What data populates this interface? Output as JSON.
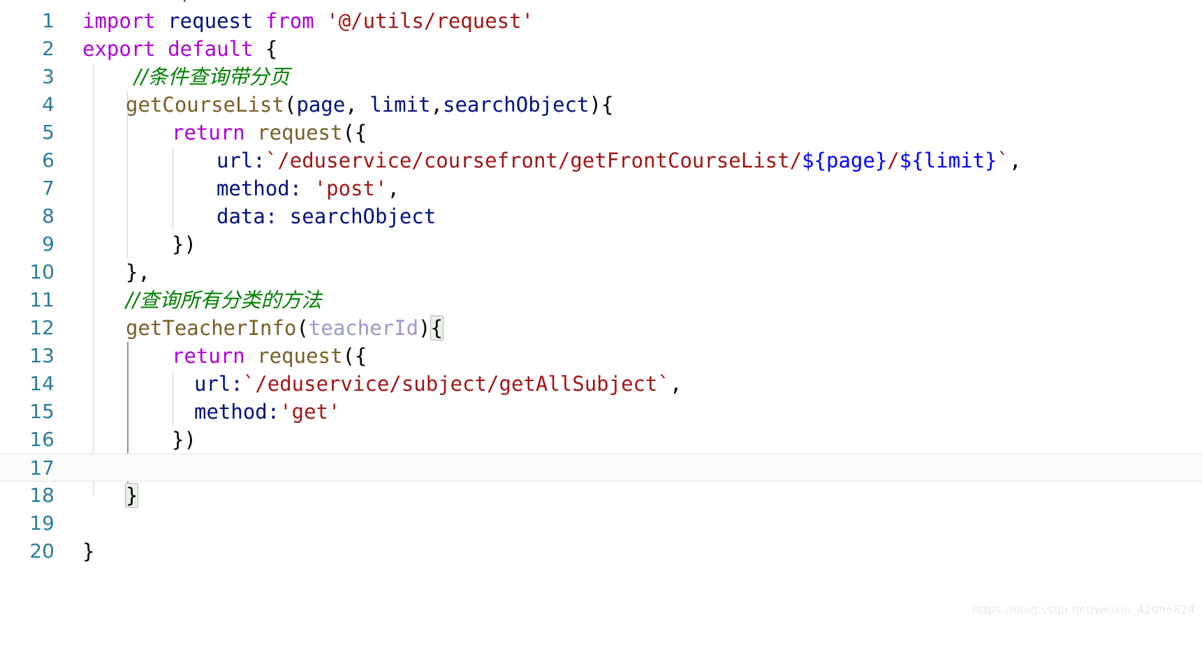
{
  "editor": {
    "title": "code-editor",
    "language": "javascript",
    "background_color": "#ffffff",
    "current_line": 17,
    "total_lines": 20,
    "top_remnant_text": "l       )",
    "gutter": {
      "line_number_color": "#2b7d99",
      "numbers": [
        "1",
        "2",
        "3",
        "4",
        "5",
        "6",
        "7",
        "8",
        "9",
        "10",
        "11",
        "12",
        "13",
        "14",
        "15",
        "16",
        "17",
        "18",
        "19",
        "20"
      ]
    },
    "theme_colors": {
      "keyword": "#af00db",
      "identifier": "#001080",
      "string": "#a31515",
      "comment": "#008000",
      "function": "#795e26",
      "unused_param": "#9b9bc8",
      "punctuation": "#000000",
      "template_expression": "#0000ff",
      "line_number": "#2b7d99",
      "indent_guide": "#d3d3d3",
      "indent_guide_active": "#939393",
      "current_line_bg": "#fbfbfb",
      "bracket_match_bg": "#e8f0e8"
    },
    "lines": [
      {
        "n": "1",
        "text": "import request from '@/utils/request'"
      },
      {
        "n": "2",
        "text": "export default {"
      },
      {
        "n": "3",
        "text": "    //条件查询带分页"
      },
      {
        "n": "4",
        "text": "  getCourseList(page, limit,searchObject){"
      },
      {
        "n": "5",
        "text": "      return request({"
      },
      {
        "n": "6",
        "text": "        url:`/eduservice/coursefront/getFrontCourseList/${page}/${limit}`,"
      },
      {
        "n": "7",
        "text": "        method: 'post',"
      },
      {
        "n": "8",
        "text": "        data: searchObject"
      },
      {
        "n": "9",
        "text": "      })"
      },
      {
        "n": "10",
        "text": "  },"
      },
      {
        "n": "11",
        "text": "  //查询所有分类的方法"
      },
      {
        "n": "12",
        "text": "  getTeacherInfo(teacherId){"
      },
      {
        "n": "13",
        "text": "      return request({"
      },
      {
        "n": "14",
        "text": "       url:`/eduservice/subject/getAllSubject`,"
      },
      {
        "n": "15",
        "text": "       method:'get'"
      },
      {
        "n": "16",
        "text": "      })"
      },
      {
        "n": "17",
        "text": ""
      },
      {
        "n": "18",
        "text": "  }"
      },
      {
        "n": "19",
        "text": ""
      },
      {
        "n": "20",
        "text": "}"
      }
    ],
    "tokens": {
      "l1": {
        "import": "import",
        "request": " request",
        "from": " from",
        "space": " ",
        "module": "'@/utils/request'"
      },
      "l2": {
        "export": "export",
        "default": " default",
        "brace": " {"
      },
      "l3": {
        "comment": "//条件查询带分页"
      },
      "l4": {
        "fname": "getCourseList",
        "open": "(",
        "p1": "page",
        "comma1": ", ",
        "p2": "limit",
        "comma2": ",",
        "p3": "searchObject",
        "close": ")",
        "brace": "{"
      },
      "l5": {
        "return": "return",
        "fname": " request",
        "open": "({"
      },
      "l6": {
        "key": "url:",
        "str1": "`/eduservice/coursefront/getFrontCourseList/",
        "t1": "${",
        "v1": "page",
        "t2": "}",
        "slash": "/",
        "t3": "${",
        "v2": "limit",
        "t4": "}",
        "str2": "`",
        "comma": ","
      },
      "l7": {
        "key": "method:",
        "space": " ",
        "val": "'post'",
        "comma": ","
      },
      "l8": {
        "key": "data:",
        "space": " ",
        "val": "searchObject"
      },
      "l9": {
        "close": "})"
      },
      "l10": {
        "close": "},"
      },
      "l11": {
        "comment": "//查询所有分类的方法"
      },
      "l12": {
        "fname": "getTeacherInfo",
        "open": "(",
        "param": "teacherId",
        "close": ")",
        "brace": "{"
      },
      "l13": {
        "return": "return",
        "fname": " request",
        "open": "({"
      },
      "l14": {
        "key": "url:",
        "str": "`/eduservice/subject/getAllSubject`",
        "comma": ","
      },
      "l15": {
        "key": "method:",
        "val": "'get'"
      },
      "l16": {
        "close": "})"
      },
      "l18": {
        "brace": "}"
      },
      "l20": {
        "brace": "}"
      }
    }
  },
  "watermark": {
    "text": "https://blog.csdn.net/weixin_42096624"
  }
}
